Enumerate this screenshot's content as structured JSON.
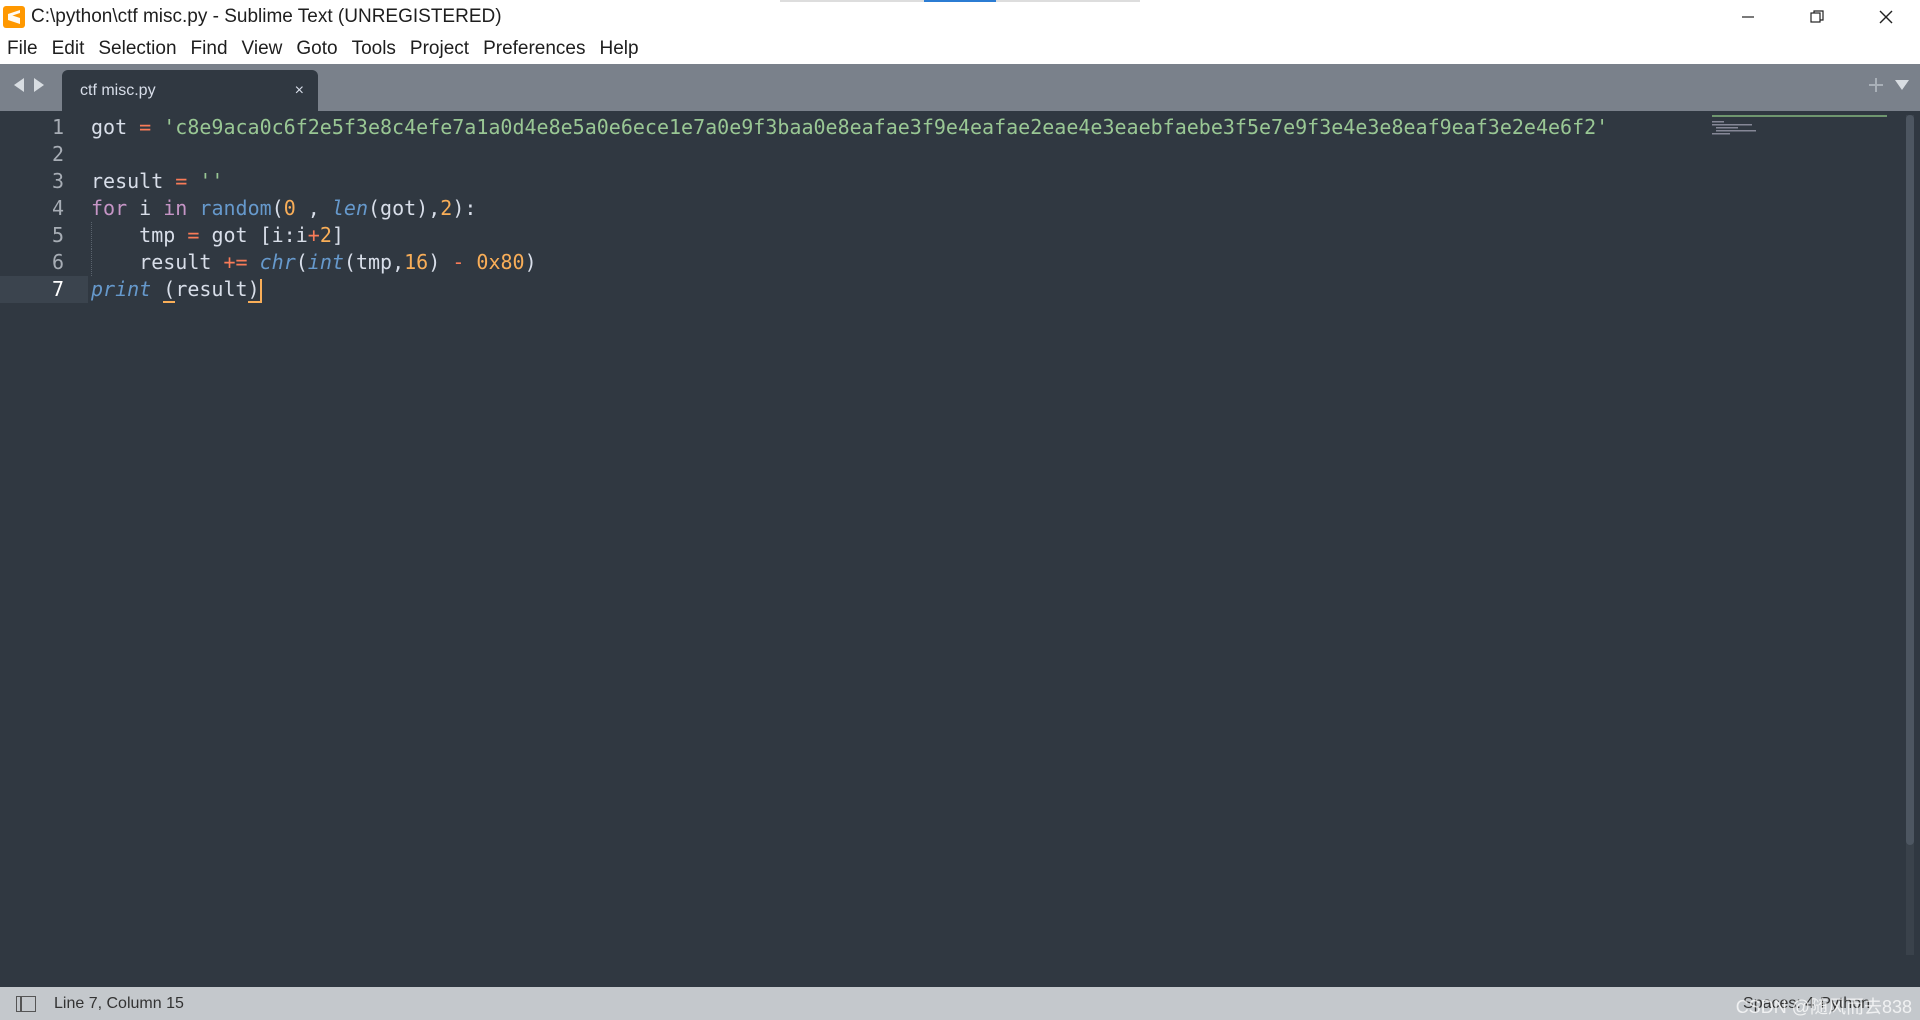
{
  "window": {
    "title": "C:\\python\\ctf misc.py - Sublime Text (UNREGISTERED)"
  },
  "menu": [
    "File",
    "Edit",
    "Selection",
    "Find",
    "View",
    "Goto",
    "Tools",
    "Project",
    "Preferences",
    "Help"
  ],
  "tabs": [
    {
      "label": "ctf misc.py",
      "close": "×"
    }
  ],
  "editor": {
    "line_numbers": [
      "1",
      "2",
      "3",
      "4",
      "5",
      "6",
      "7"
    ],
    "current_line": "7",
    "code": {
      "l1": {
        "var": "got",
        "op": "=",
        "str": "'c8e9aca0c6f2e5f3e8c4efe7a1a0d4e8e5a0e6ece1e7a0e9f3baa0e8eafae3f9e4eafae2eae4e3eaebfaebe3f5e7e9f3e4e3e8eaf9eaf3e2e4e6f2'"
      },
      "l3": {
        "var": "result",
        "op": "=",
        "str": "''"
      },
      "l4": {
        "kw_for": "for",
        "var_i": "i",
        "kw_in": "in",
        "fn": "random",
        "open": "(",
        "n0": "0",
        "sep1": " , ",
        "len": "len",
        "arg": "(got)",
        "comma": ",",
        "n2": "2",
        "close": "):"
      },
      "l5": {
        "var": "tmp",
        "op": "=",
        "rest_a": "got [i:i",
        "plus": "+",
        "n2": "2",
        "rest_b": "]"
      },
      "l6": {
        "var": "result",
        "op": "+=",
        "chr": "chr",
        "open1": "(",
        "int": "int",
        "args": "(tmp,",
        "n16": "16",
        "close1": ")",
        "minus": "-",
        "hex": "0x80",
        "close2": ")"
      },
      "l7": {
        "print": "print",
        "open": "(",
        "arg": "result",
        "close": ")"
      }
    }
  },
  "status": {
    "position": "Line 7, Column 15",
    "spaces": "Spaces: 4",
    "syntax": "Python"
  },
  "watermark": "CSDN @随风而去838",
  "colors": {
    "background": "#303841",
    "string": "#99c794",
    "operator": "#f97b58",
    "keyword": "#c695c6",
    "function": "#6699cc",
    "number": "#f9ae58"
  }
}
